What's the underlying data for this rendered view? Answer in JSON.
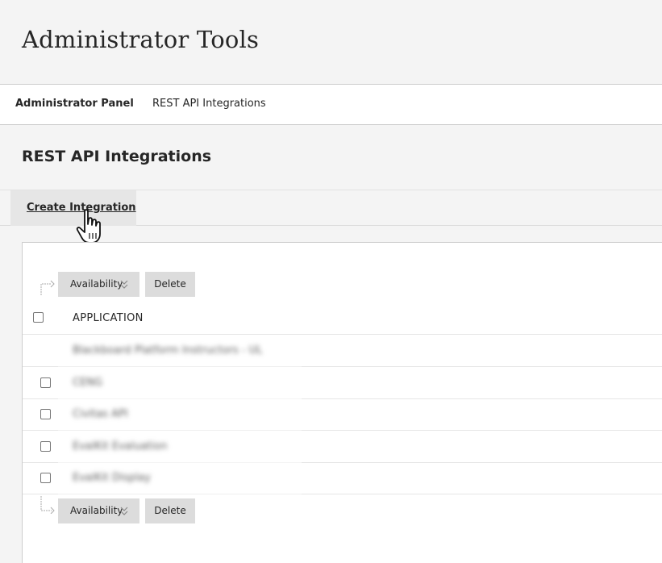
{
  "header": {
    "title": "Administrator Tools"
  },
  "breadcrumb": {
    "items": [
      "Administrator Panel",
      "REST API Integrations"
    ]
  },
  "section": {
    "title": "REST API Integrations"
  },
  "actions": {
    "create_label": "Create Integration"
  },
  "toolbar": {
    "availability_label": "Availability",
    "delete_label": "Delete"
  },
  "table": {
    "column_header": "APPLICATION",
    "rows": [
      {
        "name": "Blackboard Platform Instructors - UL",
        "has_checkbox": false
      },
      {
        "name": "CENG",
        "has_checkbox": true
      },
      {
        "name": "Civitas API",
        "has_checkbox": true
      },
      {
        "name": "EvalKit Evaluation",
        "has_checkbox": true
      },
      {
        "name": "EvalKit Display",
        "has_checkbox": true
      }
    ]
  },
  "colors": {
    "toolbar_button": "#dcdcdc",
    "create_button": "#e6e6e6",
    "page_bg": "#f4f4f4"
  }
}
